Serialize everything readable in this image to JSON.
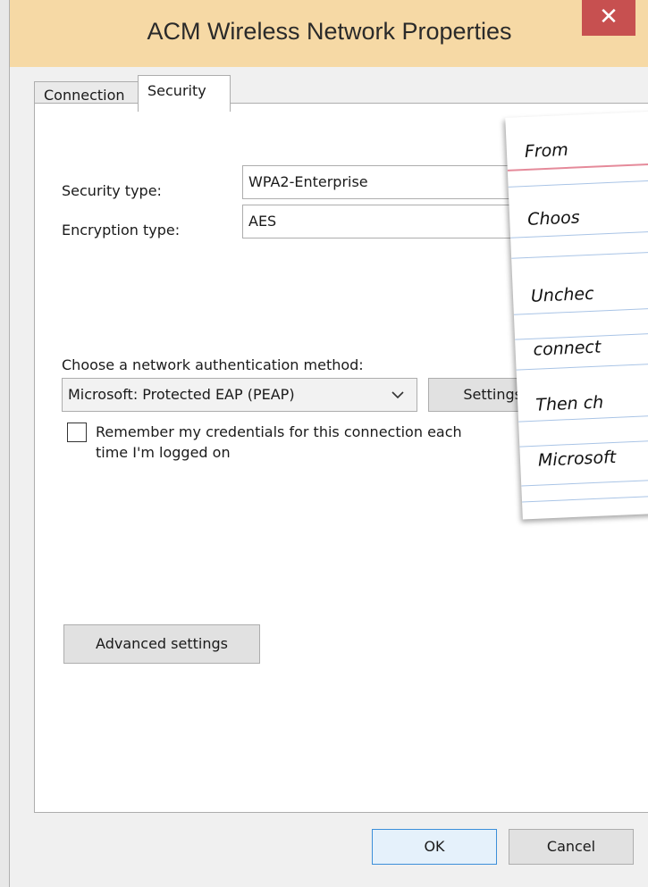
{
  "window": {
    "title": "ACM Wireless Network Properties",
    "close_glyph": "✕"
  },
  "tabs": [
    {
      "label": "Connection",
      "active": false
    },
    {
      "label": "Security",
      "active": true
    }
  ],
  "security": {
    "security_type_label": "Security type:",
    "security_type_value": "WPA2-Enterprise",
    "encryption_type_label": "Encryption type:",
    "encryption_type_value": "AES",
    "auth_method_label": "Choose a network authentication method:",
    "auth_method_value": "Microsoft: Protected EAP (PEAP)",
    "settings_button": "Settings",
    "remember_credentials_label_line1": "Remember my credentials for this connection each",
    "remember_credentials_label_line2": "time I'm logged on",
    "remember_credentials_checked": false,
    "advanced_button": "Advanced settings"
  },
  "note": {
    "lines": [
      "From",
      "Choos",
      "Unchec",
      "connect",
      "Then ch",
      "Microsoft"
    ]
  },
  "footer": {
    "ok": "OK",
    "cancel": "Cancel"
  },
  "colors": {
    "titlebar": "#f6d9a5",
    "close": "#c75050",
    "ok_border": "#3c8fd9"
  }
}
